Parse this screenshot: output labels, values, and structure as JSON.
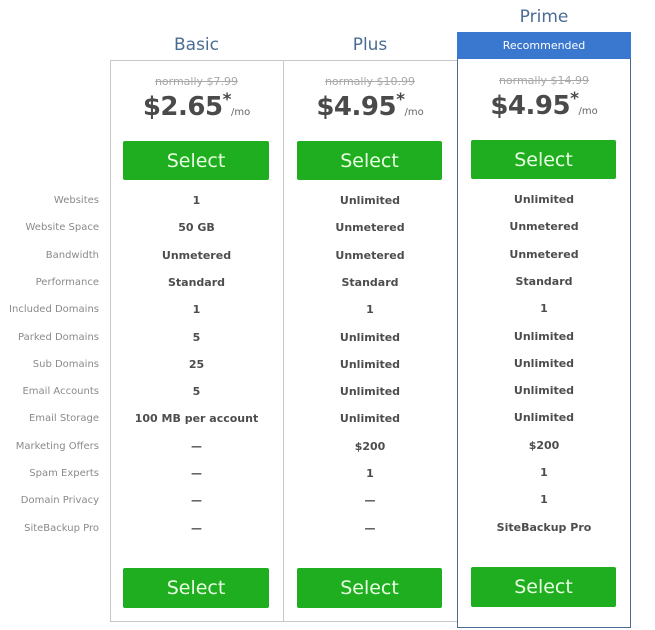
{
  "plans": [
    {
      "name": "Basic",
      "badge": null,
      "normal_price": "normally $7.99",
      "price": "$2.65",
      "asterisk": "*",
      "per": "/mo",
      "select_label": "Select",
      "features": [
        "1",
        "50 GB",
        "Unmetered",
        "Standard",
        "1",
        "5",
        "25",
        "5",
        "100 MB per account",
        "—",
        "—",
        "—",
        "—"
      ]
    },
    {
      "name": "Plus",
      "badge": null,
      "normal_price": "normally $10.99",
      "price": "$4.95",
      "asterisk": "*",
      "per": "/mo",
      "select_label": "Select",
      "features": [
        "Unlimited",
        "Unmetered",
        "Unmetered",
        "Standard",
        "1",
        "Unlimited",
        "Unlimited",
        "Unlimited",
        "Unlimited",
        "$200",
        "1",
        "—",
        "—"
      ]
    },
    {
      "name": "Prime",
      "badge": "Recommended",
      "normal_price": "normally $14.99",
      "price": "$4.95",
      "asterisk": "*",
      "per": "/mo",
      "select_label": "Select",
      "features": [
        "Unlimited",
        "Unmetered",
        "Unmetered",
        "Standard",
        "1",
        "Unlimited",
        "Unlimited",
        "Unlimited",
        "Unlimited",
        "$200",
        "1",
        "1",
        "SiteBackup Pro"
      ]
    }
  ],
  "feature_labels": [
    "Websites",
    "Website Space",
    "Bandwidth",
    "Performance",
    "Included Domains",
    "Parked Domains",
    "Sub Domains",
    "Email Accounts",
    "Email Storage",
    "Marketing Offers",
    "Spam Experts",
    "Domain Privacy",
    "SiteBackup Pro"
  ],
  "colors": {
    "accent_green": "#1fae1f",
    "recommended_blue": "#3a77cf",
    "title_blue": "#4a6c93"
  }
}
